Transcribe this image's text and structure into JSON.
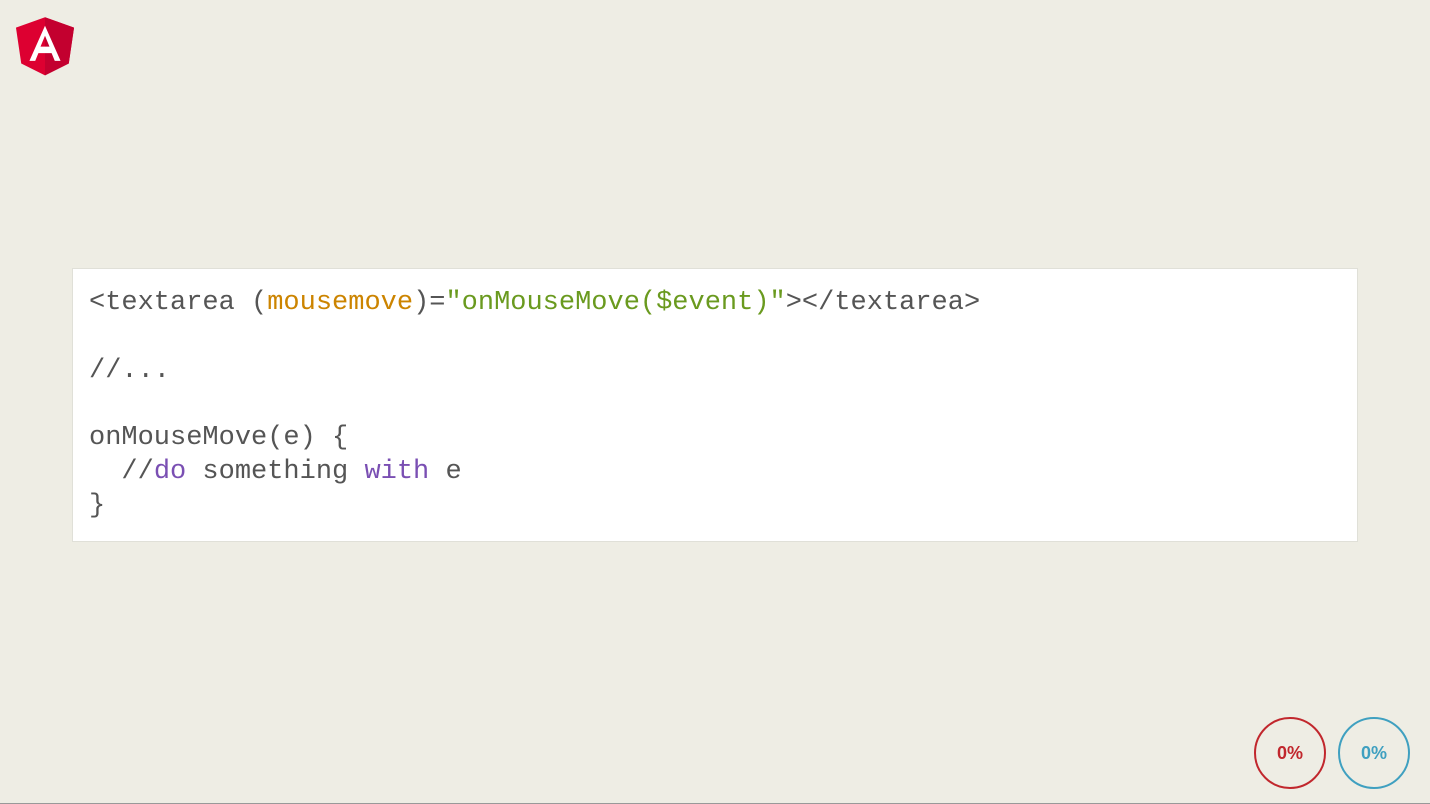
{
  "logo": {
    "letter": "A"
  },
  "code": {
    "l1_a": "<textarea (",
    "l1_b": "mousemove",
    "l1_c": ")=",
    "l1_d": "\"onMouseMove($event)\"",
    "l1_e": "></textarea>",
    "l2": "",
    "l3": "//...",
    "l4": "",
    "l5": "onMouseMove(e) {",
    "l6_a": "  //",
    "l6_b": "do",
    "l6_c": " something ",
    "l6_d": "with",
    "l6_e": " e",
    "l7": "}"
  },
  "badges": {
    "left": "0%",
    "right": "0%"
  }
}
